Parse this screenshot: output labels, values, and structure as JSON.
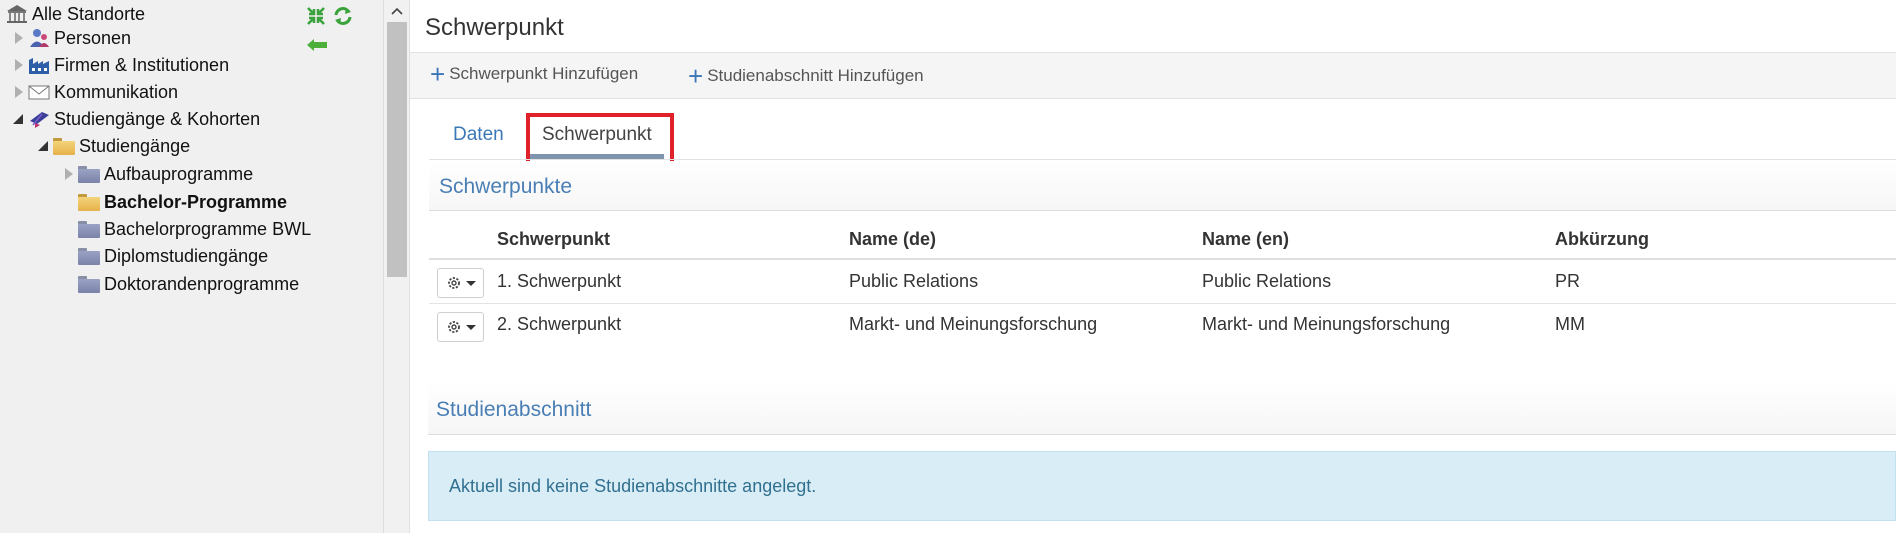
{
  "tree": {
    "root": "Alle Standorte",
    "items": [
      {
        "label": "Personen"
      },
      {
        "label": "Firmen & Institutionen"
      },
      {
        "label": "Kommunikation"
      },
      {
        "label": "Studiengänge & Kohorten"
      },
      {
        "label": "Studiengänge"
      },
      {
        "label": "Aufbauprogramme"
      },
      {
        "label": "Bachelor-Programme"
      },
      {
        "label": "Bachelorprogramme BWL"
      },
      {
        "label": "Diplomstudiengänge"
      },
      {
        "label": "Doktorandenprogramme"
      }
    ]
  },
  "page": {
    "title": "Schwerpunkt"
  },
  "toolbar": {
    "add_schwerpunkt": "Schwerpunkt Hinzufügen",
    "add_studienabschnitt": "Studienabschnitt Hinzufügen"
  },
  "tabs": [
    {
      "label": "Daten",
      "active": false
    },
    {
      "label": "Schwerpunkt",
      "active": true
    }
  ],
  "schwerpunkte": {
    "title": "Schwerpunkte",
    "columns": [
      "Schwerpunkt",
      "Name (de)",
      "Name (en)",
      "Abkürzung"
    ],
    "rows": [
      [
        "1. Schwerpunkt",
        "Public Relations",
        "Public Relations",
        "PR"
      ],
      [
        "2. Schwerpunkt",
        "Markt- und Meinungsforschung",
        "Markt- und Meinungsforschung",
        "MM"
      ]
    ]
  },
  "studienabschnitt": {
    "title": "Studienabschnitt",
    "empty_message": "Aktuell sind keine Studienabschnitte angelegt."
  },
  "colors": {
    "accent": "#3b78b6",
    "highlight": "#e0202a",
    "notice_bg": "#d9edf7"
  }
}
